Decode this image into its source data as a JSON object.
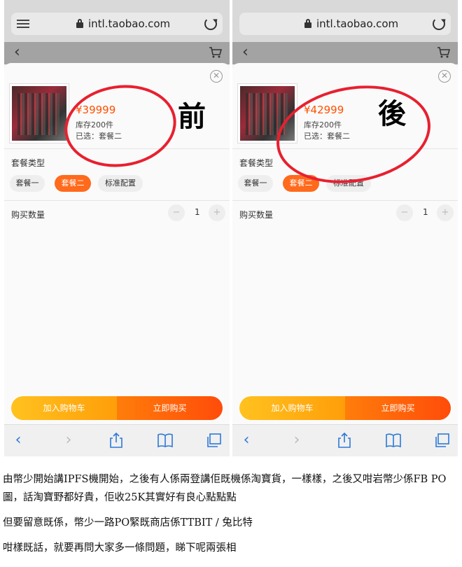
{
  "browser": {
    "url": "intl.taobao.com"
  },
  "panels": [
    {
      "price": "¥39999",
      "stock": "库存200件",
      "selected": "已选：套餐二",
      "stamp": "前",
      "type_label": "套餐类型",
      "options": [
        "套餐一",
        "套餐二",
        "标准配置"
      ],
      "active_option": "套餐二",
      "qty_label": "购买数量",
      "qty": "1",
      "add_to_cart": "加入购物车",
      "buy_now": "立即购买"
    },
    {
      "price": "¥42999",
      "stock": "库存200件",
      "selected": "已选：套餐二",
      "stamp": "後",
      "type_label": "套餐类型",
      "options": [
        "套餐一",
        "套餐二",
        "标准配置"
      ],
      "active_option": "套餐二",
      "qty_label": "购买数量",
      "qty": "1",
      "add_to_cart": "加入购物车",
      "buy_now": "立即购买"
    }
  ],
  "icons": {
    "menu": "menu-icon",
    "lock": "lock-icon",
    "reload": "reload-icon",
    "back": "chevron-left-icon",
    "cart": "cart-icon",
    "close": "close-icon",
    "share": "share-icon",
    "bookmarks": "book-icon",
    "tabs": "tabs-icon"
  },
  "colors": {
    "accent": "#ff5000",
    "annotation": "#e8202f",
    "link": "#2c79d8"
  },
  "article": {
    "p1": "由幣少開始講IPFS機開始，之後有人係兩登講佢既機係淘寶貨，一樣樣，之後又咁岩幣少係FB PO圖，話淘寶野都好貴，佢收25K其實好有良心點點點",
    "p2": "但要留意既係，幣少一路PO緊既商店係TTBIT / 兔比特",
    "p3": "咁樣既話，就要再問大家多一條問題，睇下呢兩張相"
  }
}
